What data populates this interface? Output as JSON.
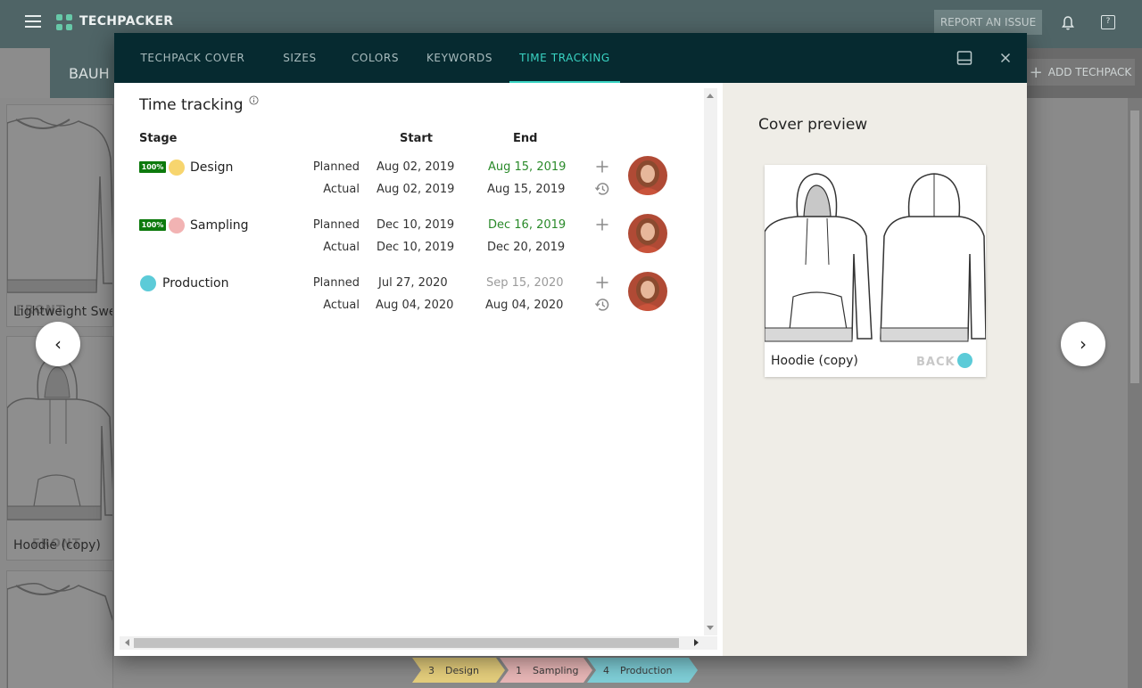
{
  "app": {
    "brand": "TECHPACKER",
    "report_label": "REPORT AN ISSUE",
    "project": "BAUH",
    "add_techpack": "ADD TECHPACK",
    "add_glyph": "+"
  },
  "background_cards": [
    {
      "caption": "Lightweight Swe",
      "ghost": "FRONT"
    },
    {
      "caption": "Hoodie (copy)",
      "ghost": "FRONT"
    },
    {
      "caption": ""
    }
  ],
  "nav": {
    "prev": "‹",
    "next": "›"
  },
  "pipeline": [
    {
      "count": "3",
      "label": "Design",
      "color": "#e6cf7d"
    },
    {
      "count": "1",
      "label": "Sampling",
      "color": "#e9b7b7"
    },
    {
      "count": "4",
      "label": "Production",
      "color": "#7fcfd8"
    }
  ],
  "modal": {
    "tabs": [
      {
        "label": "TECHPACK COVER",
        "active": false
      },
      {
        "label": "SIZES",
        "active": false
      },
      {
        "label": "COLORS",
        "active": false
      },
      {
        "label": "KEYWORDS",
        "active": false
      },
      {
        "label": "TIME TRACKING",
        "active": true
      }
    ],
    "time_tracking": {
      "title": "Time tracking",
      "headers": {
        "stage": "Stage",
        "start": "Start",
        "end": "End"
      },
      "stages": [
        {
          "name": "Design",
          "progress": "100%",
          "color": "#f7d56e",
          "planned_label": "Planned",
          "planned_start": "Aug 02, 2019",
          "planned_end": "Aug 15, 2019",
          "planned_end_style": "green",
          "actual_label": "Actual",
          "actual_start": "Aug 02, 2019",
          "actual_end": "Aug 15, 2019",
          "has_history": true
        },
        {
          "name": "Sampling",
          "progress": "100%",
          "color": "#f2b3b3",
          "planned_label": "Planned",
          "planned_start": "Dec 10, 2019",
          "planned_end": "Dec 16, 2019",
          "planned_end_style": "green",
          "actual_label": "Actual",
          "actual_start": "Dec 10, 2019",
          "actual_end": "Dec 20, 2019",
          "has_history": false
        },
        {
          "name": "Production",
          "progress": "",
          "color": "#5ccbd8",
          "planned_label": "Planned",
          "planned_start": "Jul 27, 2020",
          "planned_end": "Sep 15, 2020",
          "planned_end_style": "grey",
          "actual_label": "Actual",
          "actual_start": "Aug 04, 2020",
          "actual_end": "Aug 04, 2020",
          "has_history": true
        }
      ]
    },
    "cover_preview": {
      "title": "Cover preview",
      "caption": "Hoodie (copy)",
      "back_label": "BACK",
      "dot_color": "#5ccbd8"
    }
  }
}
